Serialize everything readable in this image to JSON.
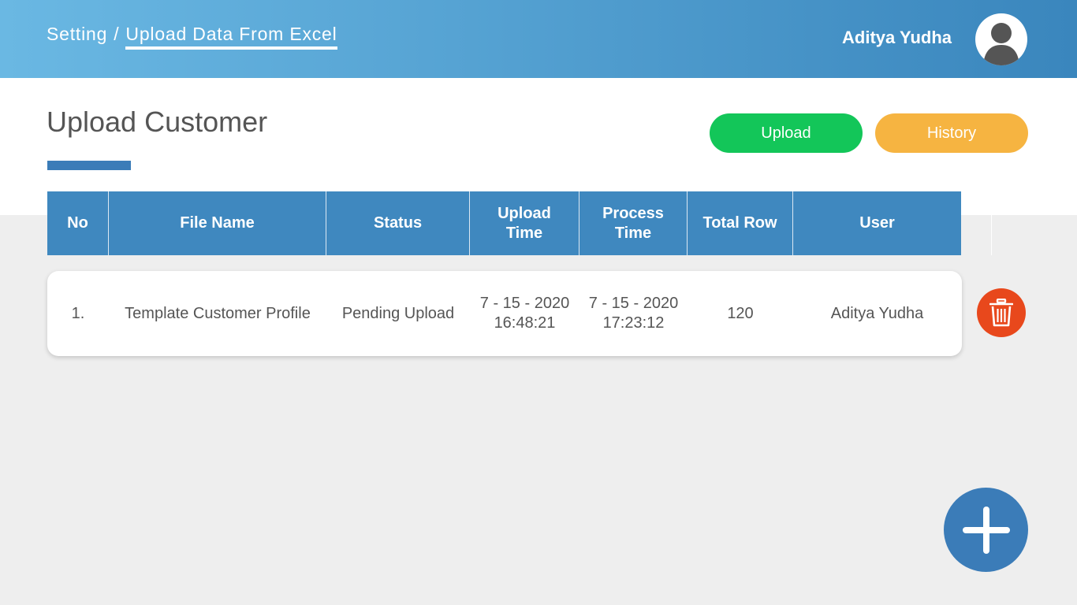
{
  "header": {
    "breadcrumb_root": "Setting",
    "breadcrumb_separator": "/",
    "breadcrumb_current": "Upload Data From Excel",
    "user_name": "Aditya Yudha",
    "avatar_icon": "user-avatar-icon"
  },
  "page": {
    "title": "Upload Customer",
    "upload_label": "Upload",
    "history_label": "History"
  },
  "colors": {
    "header_start": "#6ab8e3",
    "header_end": "#3a86bd",
    "accent_blue": "#3b7cb8",
    "upload_green": "#13c659",
    "history_orange": "#f6b441",
    "delete_red": "#e8481c"
  },
  "table": {
    "columns": [
      "No",
      "File Name",
      "Status",
      "Upload Time",
      "Process Time",
      "Total Row",
      "User"
    ],
    "rows": [
      {
        "no": "1.",
        "file_name": "Template Customer Profile",
        "status": "Pending Upload",
        "upload_date": "7 - 15 - 2020",
        "upload_time": "16:48:21",
        "process_date": "7 - 15 - 2020",
        "process_time": "17:23:12",
        "total_row": "120",
        "user": "Aditya Yudha"
      }
    ]
  },
  "actions": {
    "delete_icon": "trash-icon",
    "add_icon": "plus-icon"
  }
}
